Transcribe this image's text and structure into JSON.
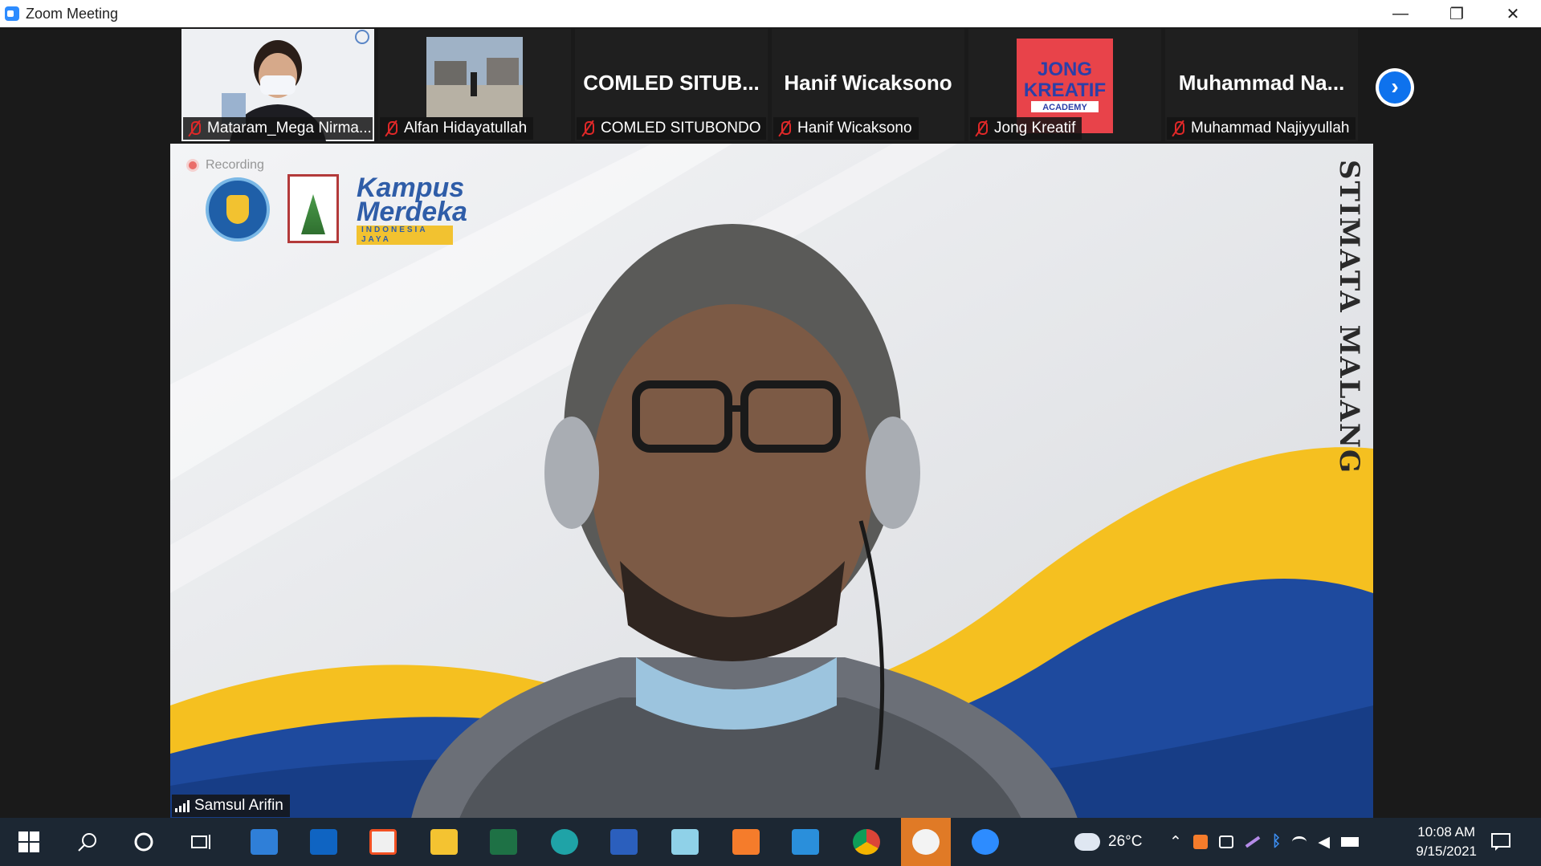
{
  "window": {
    "title": "Zoom Meeting",
    "minimize": "—",
    "restore": "❐",
    "close": "✕"
  },
  "thumbnails": [
    {
      "name": "Mataram_Mega Nirma...",
      "big_label": "",
      "kind": "video-woman"
    },
    {
      "name": "Alfan Hidayatullah",
      "big_label": "",
      "kind": "video-building"
    },
    {
      "name": "COMLED SITUBONDO",
      "big_label": "COMLED  SITUB...",
      "kind": "name-only"
    },
    {
      "name": "Hanif Wicaksono",
      "big_label": "Hanif Wicaksono",
      "kind": "name-only"
    },
    {
      "name": "Jong Kreatif",
      "big_label": "",
      "kind": "logo"
    },
    {
      "name": "Muhammad Najiyyullah",
      "big_label": "Muhammad  Na...",
      "kind": "name-only"
    }
  ],
  "next_page_icon": "chevron-right-icon",
  "logo_texts": {
    "jong": "JONG",
    "kreatif": "KREATIF",
    "academy": "ACADEMY"
  },
  "speaker": {
    "name": "Samsul Arifin",
    "recording_label": "Recording",
    "background_vertical_text": "STIMATA MALANG",
    "kampus_line1": "Kampus",
    "kampus_line2": "Merdeka",
    "kampus_sub": "INDONESIA JAYA"
  },
  "colors": {
    "accent": "#0e72ed",
    "taskbar": "#1c2733",
    "mic_off": "#e02828",
    "wave_yellow": "#f5c020",
    "wave_blue": "#1e4a9e"
  },
  "taskbar": {
    "apps": [
      "windows-start-icon",
      "search-icon",
      "cortana-icon",
      "task-view-icon",
      "mail-icon",
      "outlook-icon",
      "store-icon",
      "file-explorer-icon",
      "excel-icon",
      "edge-icon",
      "word-icon",
      "notepad-icon",
      "xampp-icon",
      "vscode-icon",
      "chrome-icon",
      "obs-icon",
      "zoom-icon"
    ],
    "weather": "26°C",
    "time": "10:08 AM",
    "date": "9/15/2021"
  }
}
